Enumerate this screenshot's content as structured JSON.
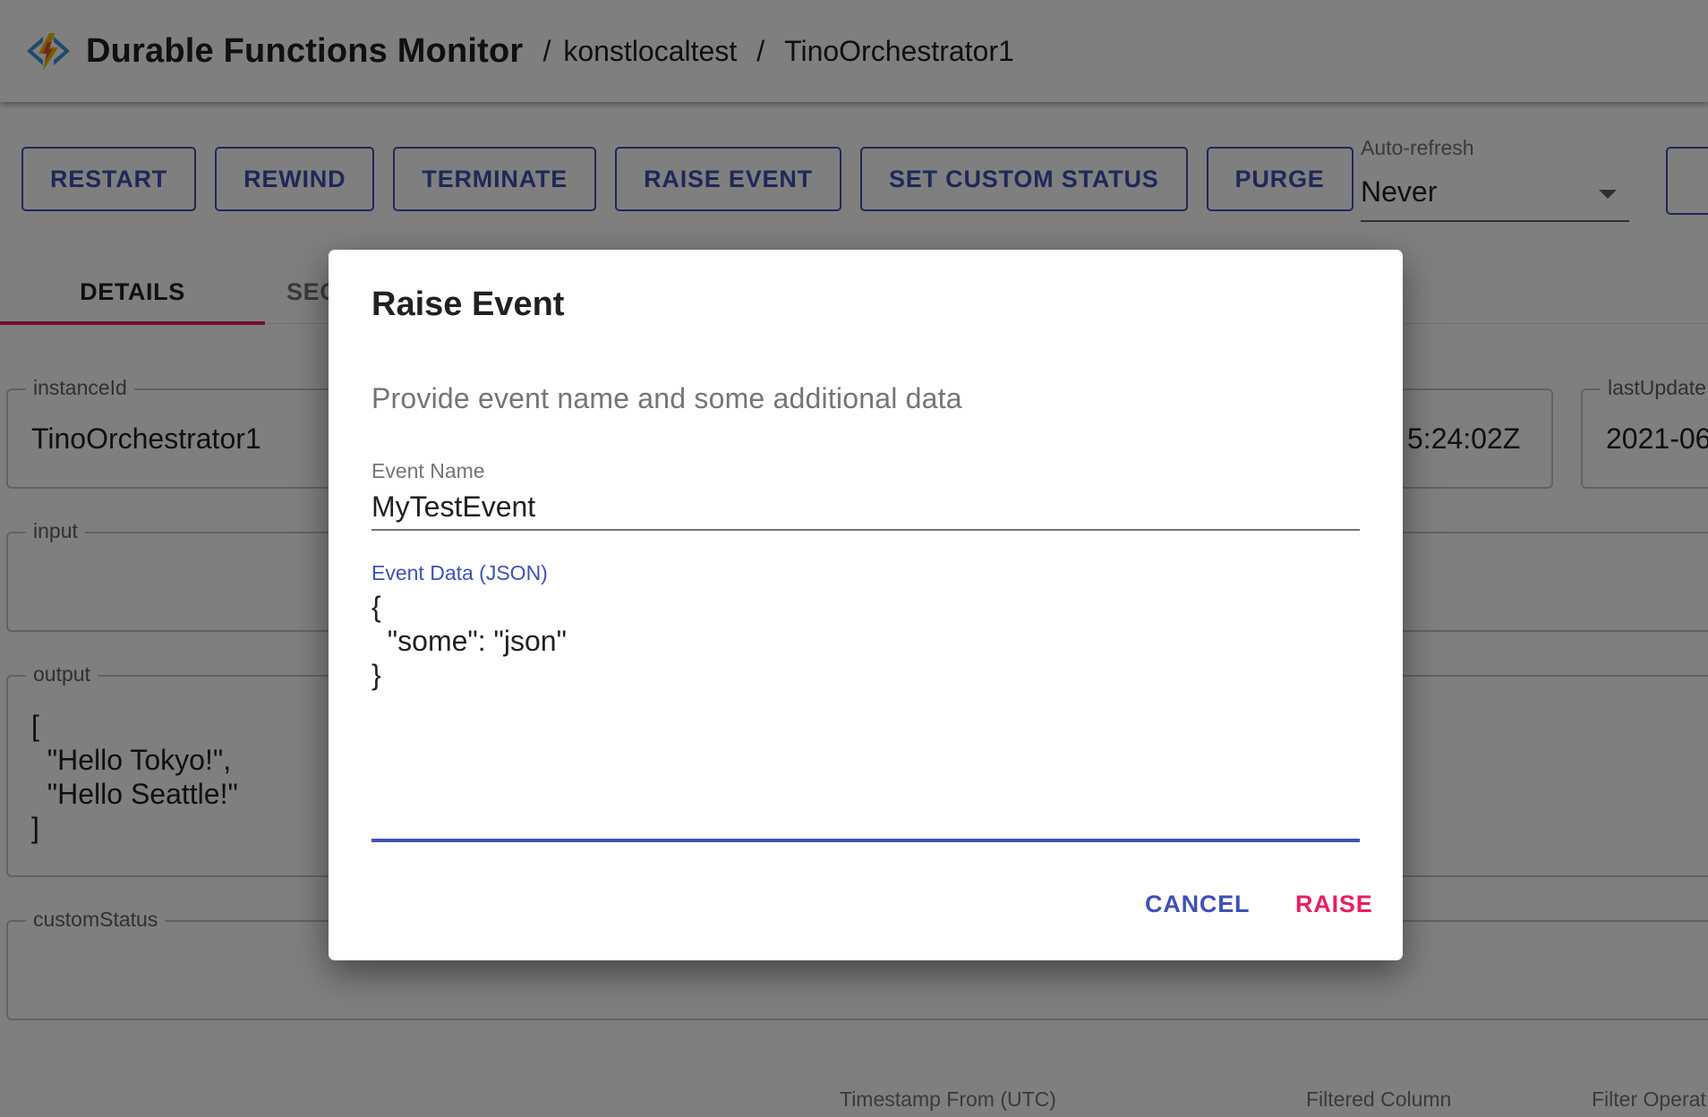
{
  "header": {
    "logo": "durable-functions-logo",
    "title": "Durable Functions Monitor",
    "breadcrumb": [
      "konstlocaltest",
      "TinoOrchestrator1"
    ],
    "separator": "/"
  },
  "toolbar": {
    "buttons": [
      "RESTART",
      "REWIND",
      "TERMINATE",
      "RAISE EVENT",
      "SET CUSTOM STATUS",
      "PURGE"
    ],
    "auto_refresh_label": "Auto-refresh",
    "auto_refresh_value": "Never"
  },
  "tabs": {
    "details": "DETAILS",
    "sequence_partial": "SEC"
  },
  "details": {
    "instanceId_label": "instanceId",
    "instanceId_value": "TinoOrchestrator1",
    "created_value_partial": "5:24:02Z",
    "lastUpdated_label_partial": "lastUpdate",
    "lastUpdated_value_partial": "2021-06",
    "input_label": "input",
    "output_label": "output",
    "output_value": "[\n  \"Hello Tokyo!\",\n  \"Hello Seattle!\"\n]",
    "customStatus_label": "customStatus"
  },
  "history_filters": {
    "timestamp_from": "Timestamp From (UTC)",
    "filtered_column": "Filtered Column",
    "filter_operator_partial": "Filter Operat"
  },
  "dialog": {
    "title": "Raise Event",
    "text": "Provide event name and some additional data",
    "event_name_label": "Event Name",
    "event_name_value": "MyTestEvent",
    "event_data_label": "Event Data (JSON)",
    "event_data_value": "{\n  \"some\": \"json\"\n}",
    "cancel_label": "CANCEL",
    "raise_label": "RAISE"
  },
  "colors": {
    "primary": "#3f51b5",
    "accent": "#e91e63",
    "overlay": "rgba(0,0,0,0.5)"
  }
}
